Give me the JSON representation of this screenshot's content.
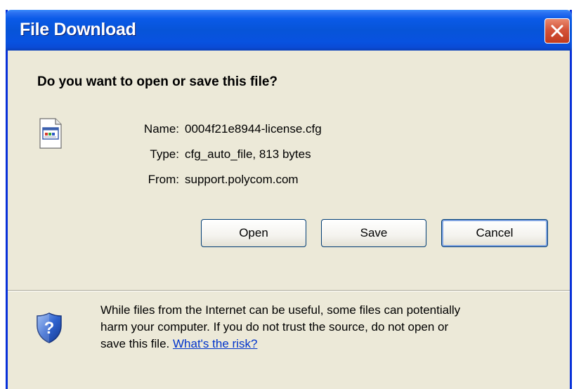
{
  "window": {
    "title": "File Download",
    "close_icon": "close-icon"
  },
  "dialog": {
    "heading": "Do you want to open or save this file?",
    "file_icon": "config-file-icon",
    "fields": {
      "name_label": "Name:",
      "name_value": "0004f21e8944-license.cfg",
      "type_label": "Type:",
      "type_value": "cfg_auto_file, 813 bytes",
      "from_label": "From:",
      "from_value": "support.polycom.com"
    },
    "buttons": {
      "open": "Open",
      "save": "Save",
      "cancel": "Cancel"
    }
  },
  "warning": {
    "icon": "security-shield-icon",
    "line1": "While files from the Internet can be useful, some files can potentially",
    "line2": "harm your computer. If you do not trust the source, do not open or",
    "line3_prefix": "save this file. ",
    "link": "What's the risk?"
  },
  "colors": {
    "titlebar": "#0754d8",
    "dialog_bg": "#ece9d8",
    "close_button": "#d4543a",
    "link": "#0033cc"
  }
}
